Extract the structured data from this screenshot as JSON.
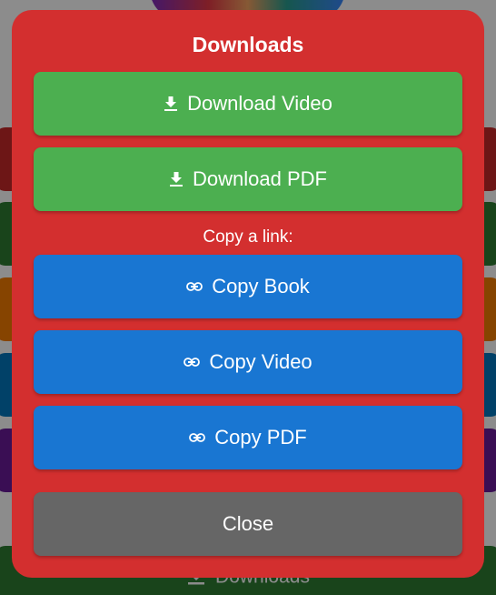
{
  "modal": {
    "title": "Downloads",
    "download_video_label": "Download Video",
    "download_pdf_label": "Download PDF",
    "copy_section_label": "Copy a link:",
    "copy_book_label": "Copy Book",
    "copy_video_label": "Copy Video",
    "copy_pdf_label": "Copy PDF",
    "close_label": "Close"
  },
  "background": {
    "footer_button_label": "Downloads"
  },
  "colors": {
    "modal_bg": "#d32f2f",
    "download_button": "#4caf50",
    "copy_button": "#1976d2",
    "close_button": "#666666",
    "text": "#ffffff"
  },
  "icons": {
    "download": "download-icon",
    "link": "link-icon"
  }
}
